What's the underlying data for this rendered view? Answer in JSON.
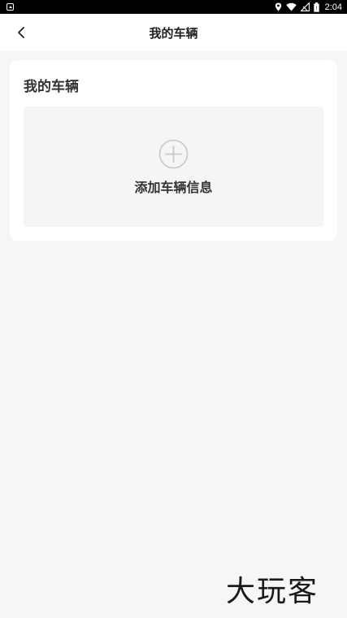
{
  "status_bar": {
    "time": "2:04",
    "icons": [
      "notification-icon",
      "location-icon",
      "wifi-icon",
      "signal-icon",
      "battery-icon"
    ]
  },
  "nav": {
    "title": "我的车辆",
    "back_icon": "chevron-left-icon"
  },
  "card": {
    "title": "我的车辆",
    "add_label": "添加车辆信息",
    "add_icon": "plus-circle-icon"
  },
  "watermark": {
    "text": "大玩客"
  },
  "colors": {
    "background": "#f6f6f6",
    "card": "#ffffff",
    "add_box": "#f5f5f5",
    "text_primary": "#333333",
    "icon_gray": "#c8c8c8"
  }
}
